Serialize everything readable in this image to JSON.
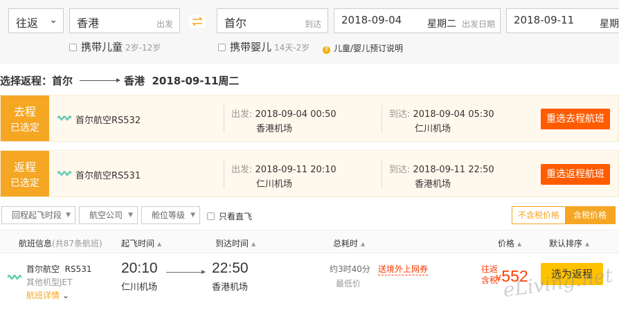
{
  "search": {
    "trip_type": "往返",
    "from_city": "香港",
    "from_tag": "出发",
    "to_city": "首尔",
    "to_tag": "到达",
    "depart_date": "2018-09-04",
    "depart_week": "星期二",
    "depart_tag": "出发日期",
    "return_date": "2018-09-11",
    "return_week": "星期",
    "child_label": "携带儿童",
    "child_age": "2岁-12岁",
    "infant_label": "携带婴儿",
    "infant_age": "14天-2岁",
    "info_link": "儿童/婴儿预订说明"
  },
  "route": {
    "prefix": "选择返程：首尔",
    "to": "香港",
    "date": "2018-09-11周二"
  },
  "selected": [
    {
      "tag1": "去程",
      "tag2": "已选定",
      "airline": "首尔航空RS532",
      "dep_label": "出发:",
      "dep_time": "2018-09-04 00:50",
      "dep_airport": "香港机场",
      "arr_label": "到达:",
      "arr_time": "2018-09-04 05:30",
      "arr_airport": "仁川机场",
      "button": "重选去程航班"
    },
    {
      "tag1": "返程",
      "tag2": "已选定",
      "airline": "首尔航空RS531",
      "dep_label": "出发:",
      "dep_time": "2018-09-11 20:10",
      "dep_airport": "仁川机场",
      "arr_label": "到达:",
      "arr_time": "2018-09-11 22:50",
      "arr_airport": "香港机场",
      "button": "重选返程航班"
    }
  ],
  "filters": {
    "depart_period": "回程起飞时段",
    "airline": "航空公司",
    "cabin": "舱位等级",
    "direct_only": "只看直飞",
    "price_excl": "不含税价格",
    "price_incl": "含税价格"
  },
  "list_header": {
    "info": "航班信息",
    "count": "(共87条航班)",
    "depart": "起飞时间",
    "arrive": "到达时间",
    "duration": "总耗时",
    "price": "价格",
    "sort": "默认排序"
  },
  "flight": {
    "airline": "首尔航空",
    "number": "RS531",
    "aircraft": "其他机型JET",
    "detail": "航班详情",
    "dep_time": "20:10",
    "dep_airport": "仁川机场",
    "arr_time": "22:50",
    "arr_airport": "香港机场",
    "duration": "约3时40分",
    "lowest": "最低价",
    "promo": "送境外上网券",
    "price_label1": "往返",
    "price_label2": "含税",
    "price_currency": "¥",
    "price": "552",
    "book": "选为返程"
  },
  "watermark": "eLiving.net",
  "colors": {
    "orange_tag": "#f5a623",
    "red_button": "#ff5b00",
    "yellow_button": "#ffc200",
    "price_red": "#ff3b00"
  }
}
